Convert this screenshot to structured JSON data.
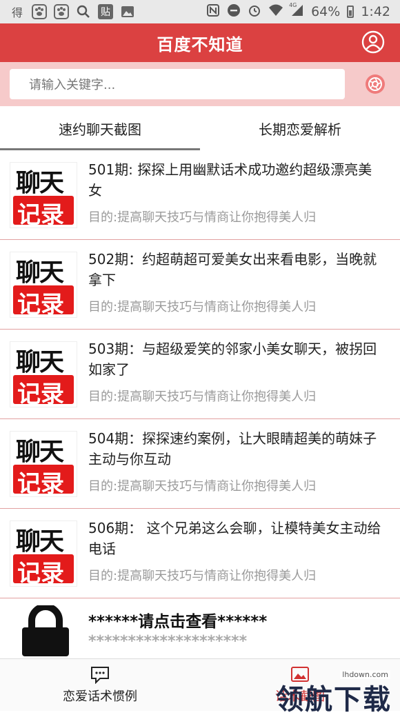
{
  "status_bar": {
    "left_icons": [
      "signal-char-icon",
      "paw-app-icon",
      "paw-app-icon-2",
      "search-icon",
      "paste-app-icon",
      "image-icon"
    ],
    "glyph_de": "得",
    "glyph_tie": "贴",
    "network_label": "4G",
    "battery": "64%",
    "time": "1:42"
  },
  "header": {
    "title": "百度不知道"
  },
  "search": {
    "placeholder": "请输入关键字..."
  },
  "tabs": [
    {
      "label": "速约聊天截图"
    },
    {
      "label": "长期恋爱解析"
    }
  ],
  "thumb": {
    "top": "聊天",
    "bottom": "记录"
  },
  "items": [
    {
      "title": "501期: 探探上用幽默话术成功邀约超级漂亮美女",
      "desc": "目的:提高聊天技巧与情商让你抱得美人归"
    },
    {
      "title": "502期：约超萌超可爱美女出来看电影，当晚就拿下",
      "desc": "目的:提高聊天技巧与情商让你抱得美人归"
    },
    {
      "title": "503期：与超级爱笑的邻家小美女聊天，被拐回如家了",
      "desc": "目的:提高聊天技巧与情商让你抱得美人归"
    },
    {
      "title": "504期：探探速约案例，让大眼睛超美的萌妹子主动与你互动",
      "desc": "目的:提高聊天技巧与情商让你抱得美人归"
    },
    {
      "title": "506期： 这个兄弟这么会聊，让模特美女主动给电话",
      "desc": "目的:提高聊天技巧与情商让你抱得美人归"
    }
  ],
  "locked_item": {
    "title": "******请点击查看******",
    "desc": "********************"
  },
  "bottom_nav": [
    {
      "label": "恋爱话术惯例",
      "icon": "chat-icon"
    },
    {
      "label": "话术截图",
      "icon": "image-icon"
    }
  ],
  "watermark": {
    "site": "lhdown.com",
    "text": "领航下载"
  }
}
